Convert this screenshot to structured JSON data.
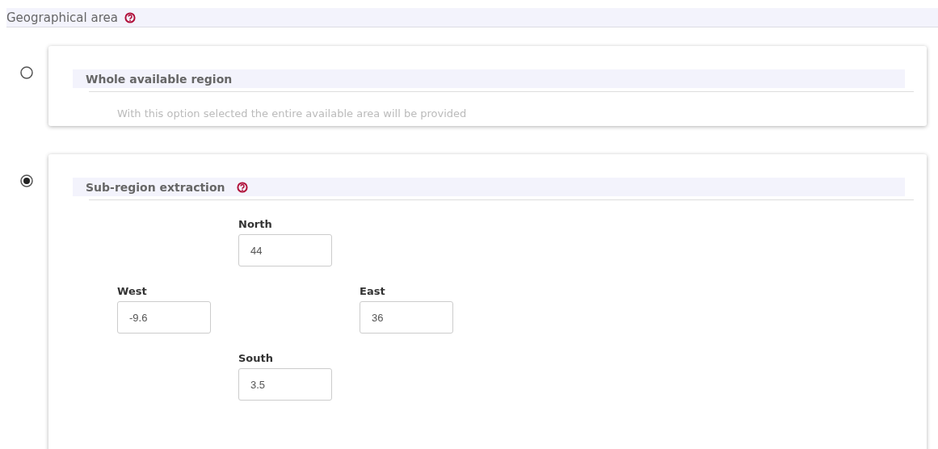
{
  "section": {
    "title": "Geographical area",
    "help": true
  },
  "options": [
    {
      "kind": "simple",
      "title": "Whole available region",
      "selected": false,
      "help": false,
      "description": "With this option selected the entire available area will be provided"
    },
    {
      "kind": "bbox",
      "title": "Sub-region extraction",
      "selected": true,
      "help": true,
      "fields": [
        {
          "label": "North",
          "value": "44"
        },
        {
          "label": "West",
          "value": "-9.6"
        },
        {
          "label": "East",
          "value": "36"
        },
        {
          "label": "South",
          "value": "3.5"
        }
      ]
    }
  ]
}
